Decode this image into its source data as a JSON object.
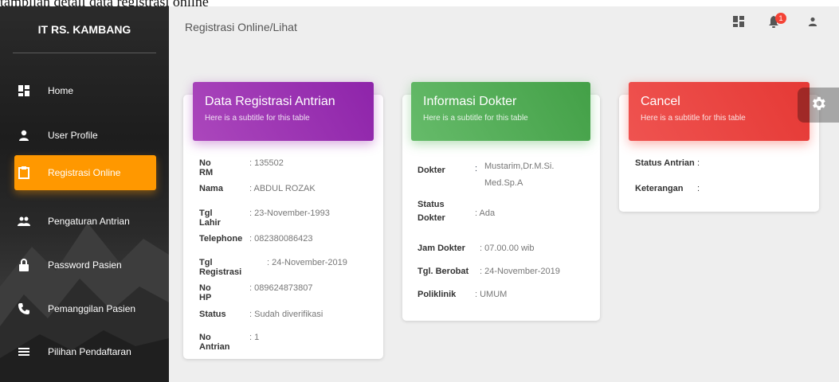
{
  "caption": "tampilan detail data registrasi online",
  "brand": "IT RS. KAMBANG",
  "breadcrumb": "Registrasi Online/Lihat",
  "notifications": {
    "count": "1"
  },
  "sidebar": {
    "items": [
      {
        "label": "Home",
        "icon": "dashboard-icon"
      },
      {
        "label": "User Profile",
        "icon": "person-icon"
      },
      {
        "label": "Registrasi Online",
        "icon": "clipboard-icon",
        "active": true
      },
      {
        "label": "Pengaturan Antrian",
        "icon": "people-icon"
      },
      {
        "label": "Password Pasien",
        "icon": "lock-icon"
      },
      {
        "label": "Pemanggilan Pasien",
        "icon": "phone-icon"
      },
      {
        "label": "Pilihan Pendaftaran",
        "icon": "list-icon"
      }
    ]
  },
  "cards": {
    "registrasi": {
      "title": "Data Registrasi Antrian",
      "subtitle": "Here is a subtitle for this table",
      "rows": [
        {
          "label": "No RM",
          "value": ": 135502"
        },
        {
          "label": "Nama",
          "value": ": ABDUL ROZAK"
        },
        {
          "label": "Tgl Lahir",
          "value": ": 23-November-1993"
        },
        {
          "label": "Telephone",
          "value": ": 082380086423"
        },
        {
          "label": "Tgl Registrasi",
          "value": ": 24-November-2019"
        },
        {
          "label": "No HP",
          "value": ": 089624873807"
        },
        {
          "label": "Status",
          "value": ": Sudah diverifikasi"
        },
        {
          "label": "No Antrian",
          "value": ": 1"
        }
      ]
    },
    "dokter": {
      "title": "Informasi Dokter",
      "subtitle": "Here is a subtitle for this table",
      "dokter_label": "Dokter",
      "dokter_colon": ":",
      "dokter_value_1": "Mustarim,Dr.M.Si.",
      "dokter_value_2": "Med.Sp.A",
      "status_label_1": "Status",
      "status_label_2": "Dokter",
      "status_value": ": Ada",
      "jam_label": "Jam Dokter",
      "jam_value": ": 07.00.00 wib",
      "berobat_label": "Tgl. Berobat",
      "berobat_value": ": 24-November-2019",
      "poli_label": "Poliklinik",
      "poli_value": ": UMUM"
    },
    "cancel": {
      "title": "Cancel",
      "subtitle": "Here is a subtitle for this table",
      "status_label": "Status Antrian",
      "status_value": ":",
      "ket_label": "Keterangan",
      "ket_value": ":"
    }
  },
  "colors": {
    "accent": "#ff9800",
    "purple": "#9c27b0",
    "green": "#4caf50",
    "red": "#f44336"
  }
}
